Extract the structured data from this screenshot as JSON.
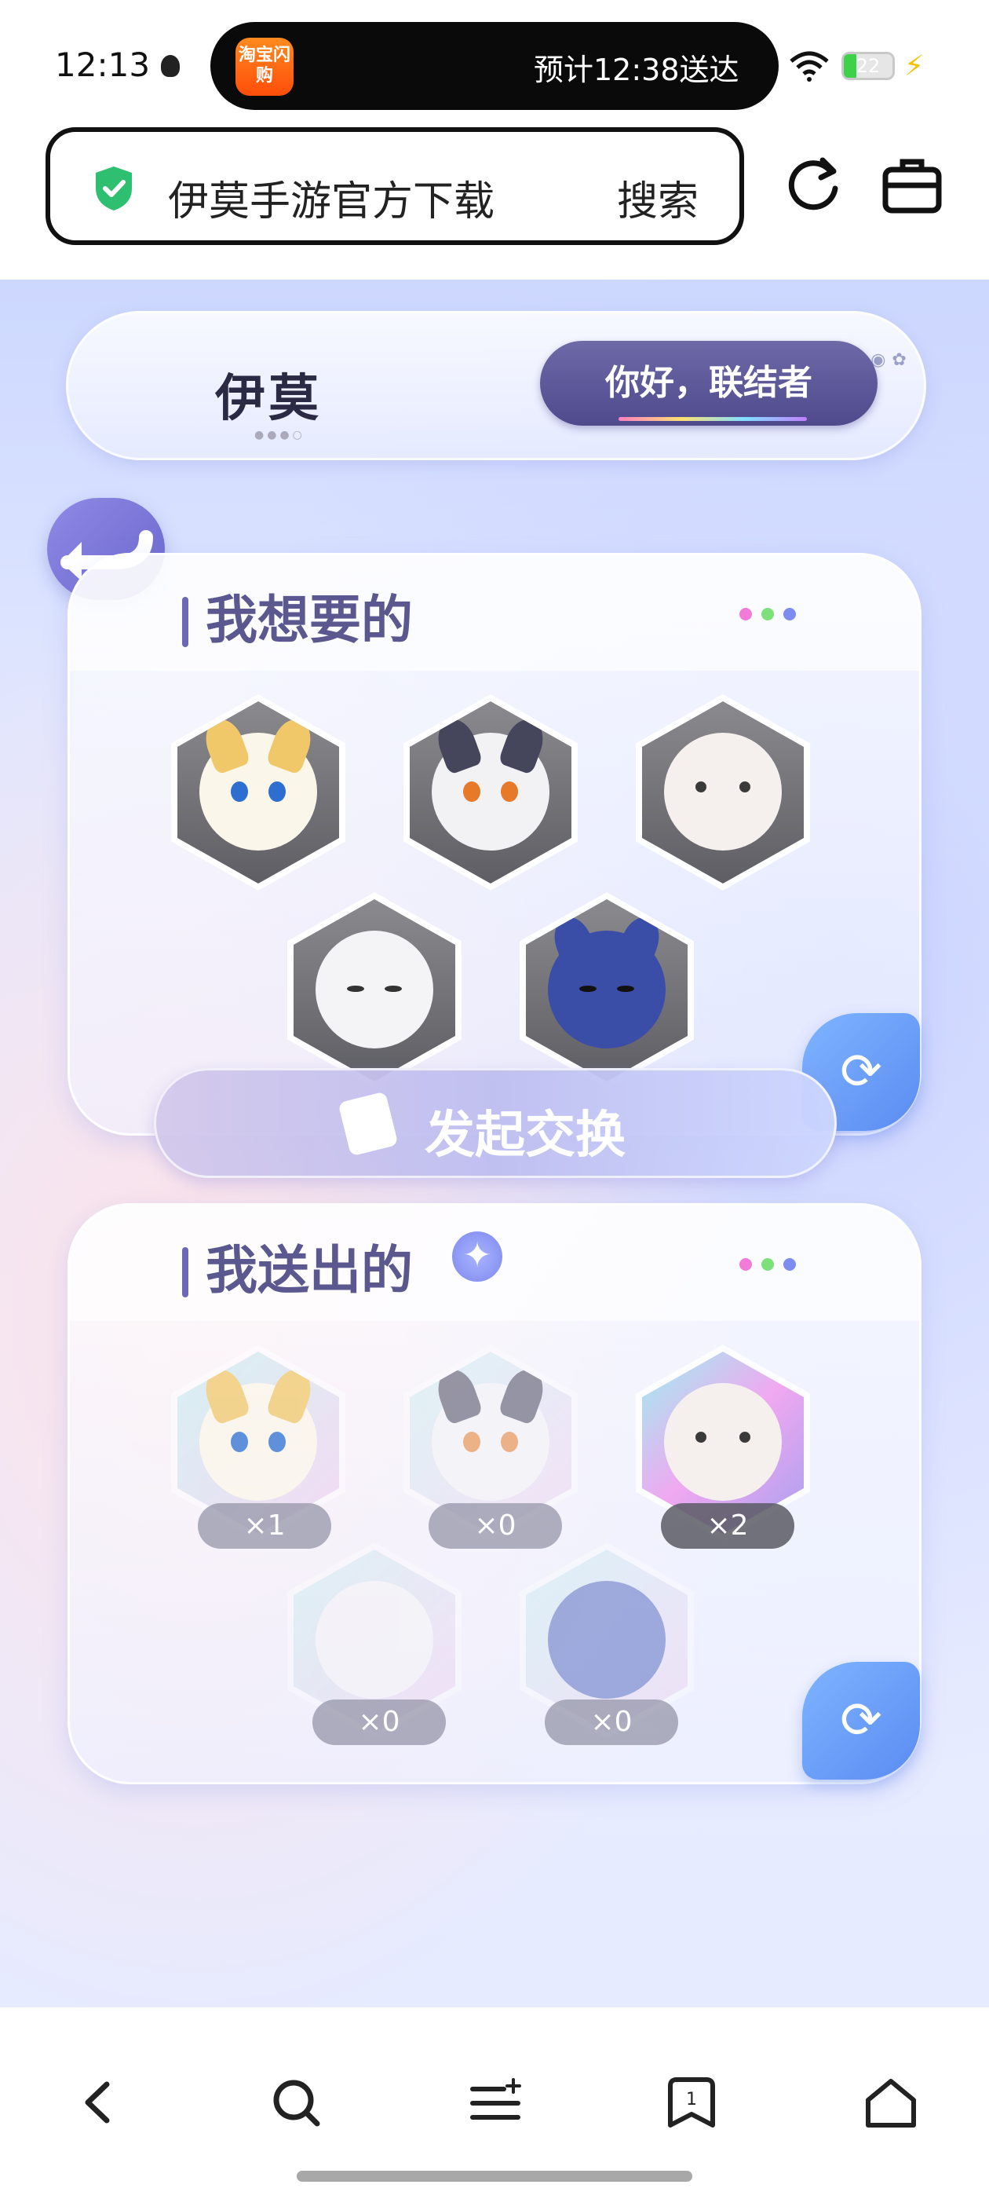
{
  "status_bar": {
    "time": "12:13",
    "app_badge": "淘宝闪购",
    "eta": "预计12:38送达",
    "battery": "22"
  },
  "search": {
    "query": "伊莫手游官方下载",
    "button": "搜索"
  },
  "game": {
    "logo": "伊莫",
    "greeting": "你好，联结者",
    "want_title": "我想要的",
    "send_title": "我送出的",
    "exchange_label": "发起交换",
    "send_quantities": [
      "×1",
      "×0",
      "×2",
      "×0",
      "×0"
    ]
  },
  "colors": {
    "accent": "#5b5890",
    "dot_pink": "#f07cd8",
    "dot_green": "#7ee07a",
    "dot_blue": "#7c8cf0"
  },
  "icons": {
    "nav": [
      "back-arrow-icon",
      "search-icon",
      "menu-icon",
      "bookmark-icon",
      "home-icon"
    ]
  }
}
